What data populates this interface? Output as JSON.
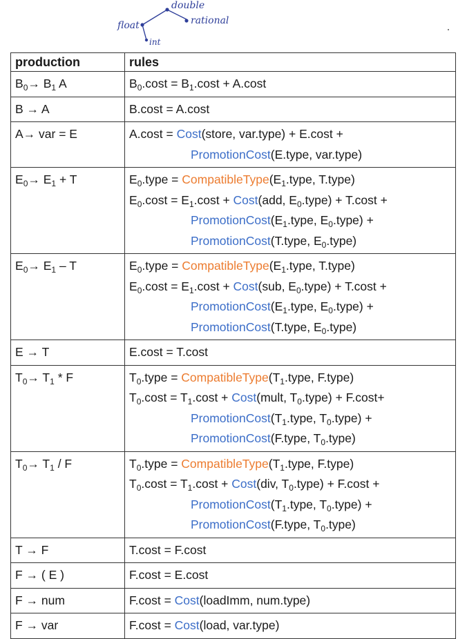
{
  "annotation": {
    "top": "double",
    "left": "float",
    "right": "rational",
    "bottom": "int"
  },
  "table": {
    "headers": [
      "production",
      "rules"
    ],
    "rows": [
      {
        "production": [
          "B₀→ B₁ A"
        ],
        "rules": [
          "B₀.cost = B₁.cost + A.cost"
        ]
      },
      {
        "production": [
          "B → A"
        ],
        "rules": [
          "B.cost = A.cost"
        ]
      },
      {
        "production": [
          "A→ var = E"
        ],
        "rules": [
          "A.cost = Cost(store, var.type) + E.cost +",
          "PromotionCost(E.type, var.type)"
        ]
      },
      {
        "production": [
          "E₀→ E₁ + T"
        ],
        "rules": [
          "E₀.type = CompatibleType(E₁.type, T.type)",
          "E₀.cost = E₁.cost + Cost(add, E₀.type) + T.cost +",
          "PromotionCost(E₁.type, E₀.type) +",
          "PromotionCost(T.type, E₀.type)"
        ]
      },
      {
        "production": [
          "E₀→ E₁ – T"
        ],
        "rules": [
          "E₀.type = CompatibleType(E₁.type, T.type)",
          "E₀.cost = E₁.cost + Cost(sub, E₀.type) + T.cost +",
          "PromotionCost(E₁.type, E₀.type) +",
          "PromotionCost(T.type, E₀.type)"
        ]
      },
      {
        "production": [
          "E → T"
        ],
        "rules": [
          "E.cost = T.cost"
        ]
      },
      {
        "production": [
          "T₀→ T₁ * F"
        ],
        "rules": [
          "T₀.type = CompatibleType(T₁.type, F.type)",
          "T₀.cost = T₁.cost + Cost(mult, T₀.type) + F.cost+",
          "PromotionCost(T₁.type, T₀.type) +",
          "PromotionCost(F.type, T₀.type)"
        ]
      },
      {
        "production": [
          "T₀→ T₁ / F"
        ],
        "rules": [
          "T₀.type = CompatibleType(T₁.type, F.type)",
          "T₀.cost = T₁.cost + Cost(div, T₀.type) + F.cost +",
          "PromotionCost(T₁.type, T₀.type) +",
          "PromotionCost(F.type, T₀.type)"
        ]
      },
      {
        "production": [
          "T → F"
        ],
        "rules": [
          "T.cost = F.cost"
        ]
      },
      {
        "production": [
          "F → ( E )"
        ],
        "rules": [
          "F.cost = E.cost"
        ]
      },
      {
        "production": [
          "F → num"
        ],
        "rules": [
          "F.cost = Cost(loadImm, num.type)"
        ]
      },
      {
        "production": [
          "F → var"
        ],
        "rules": [
          "F.cost = Cost(load, var.type)"
        ]
      }
    ]
  },
  "highlight_terms": {
    "blue": [
      "Cost",
      "PromotionCost"
    ],
    "orange": [
      "CompatibleType"
    ],
    "blue_color": "#3c6ec8",
    "orange_color": "#ec7c30"
  }
}
